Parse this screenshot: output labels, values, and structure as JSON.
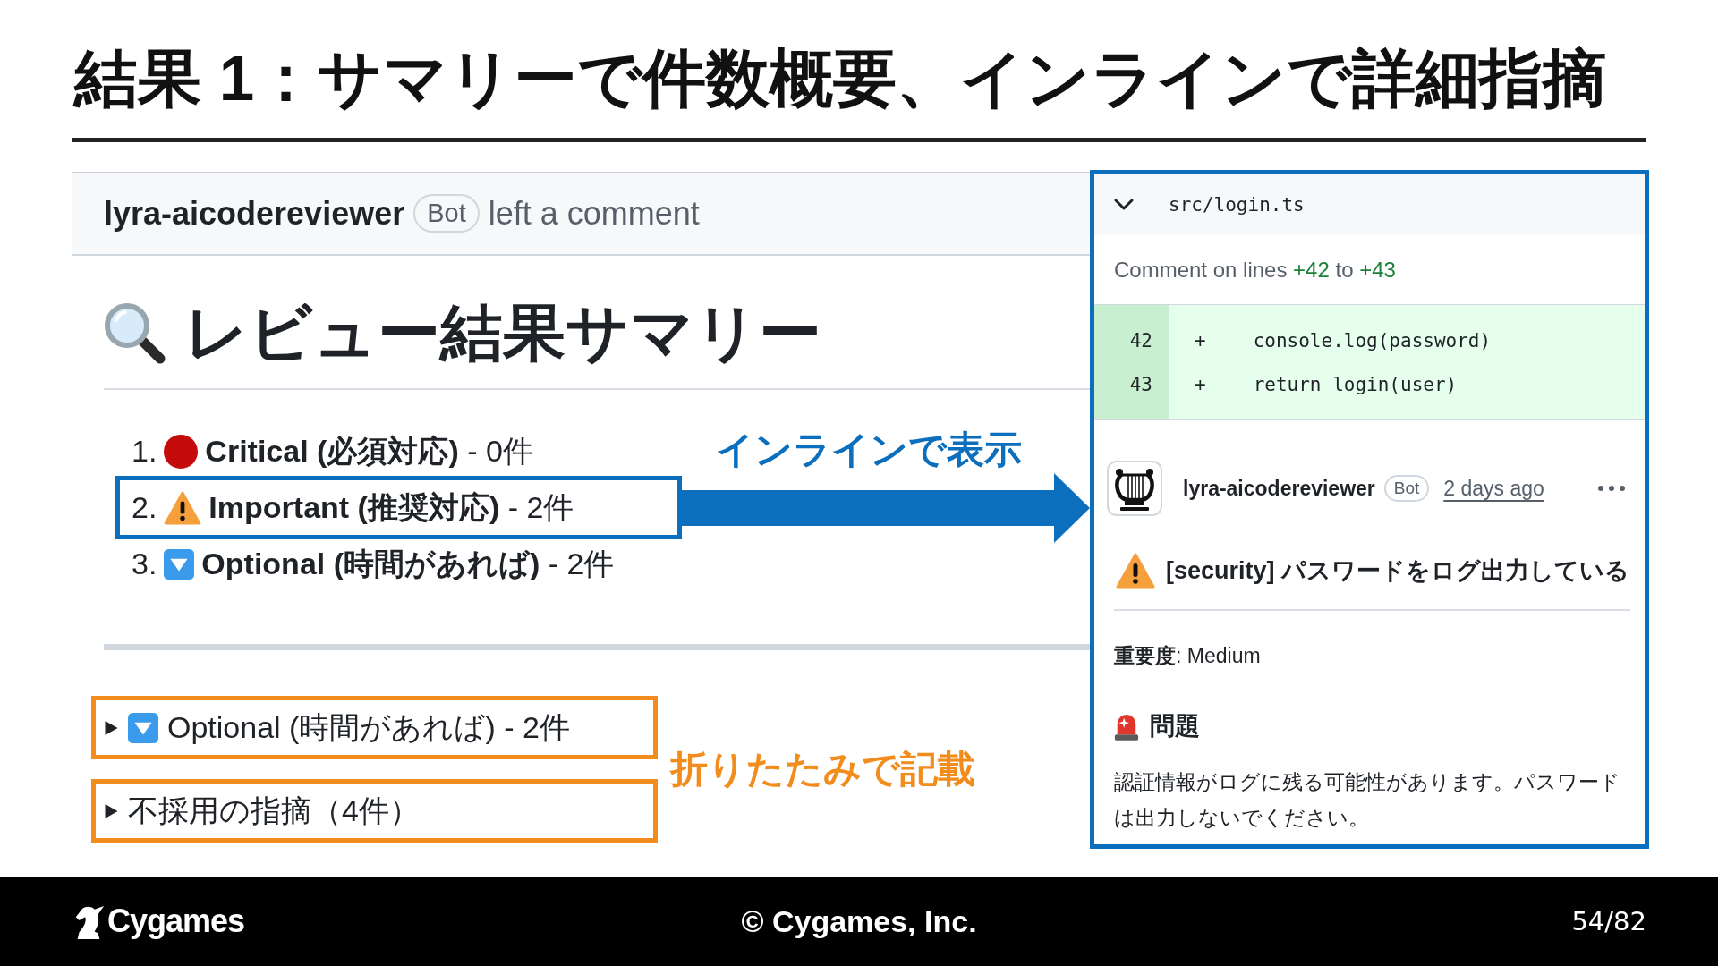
{
  "slide": {
    "title": "結果 1：サマリーで件数概要、インラインで詳細指摘"
  },
  "review_comment": {
    "author": "lyra-aicodereviewer",
    "badge": "Bot",
    "action": "left a comment",
    "heading": "レビュー結果サマリー",
    "summary_items": [
      {
        "number": "1.",
        "kind": "critical",
        "label": "**Critical (必須対応)** - 0件",
        "highlighted": false
      },
      {
        "number": "2.",
        "kind": "important",
        "label": "**Important (推奨対応)** - 2件",
        "highlighted": true
      },
      {
        "number": "3.",
        "kind": "optional",
        "label": "**Optional (時間があれば)** - 2件",
        "highlighted": false
      }
    ],
    "collapsed_sections": [
      {
        "kind": "optional",
        "label": "Optional (時間があれば) - 2件",
        "expanded": false,
        "highlighted": true
      },
      {
        "kind": "rejected",
        "label": "不採用の指摘（4件）",
        "expanded": false,
        "highlighted": true
      }
    ]
  },
  "callouts": [
    {
      "kind": "inline",
      "text": "インラインで表示"
    },
    {
      "kind": "folded",
      "text": "折りたたみで記載"
    }
  ],
  "inline_comment": {
    "file": {
      "path": "src/login.ts",
      "expanded": true
    },
    "range": {
      "prefix": "Comment on lines",
      "start": "+42",
      "joiner": "to",
      "end": "+43"
    },
    "diff_lines": [
      {
        "number": "42",
        "sign": "+",
        "code": "console.log(password)"
      },
      {
        "number": "43",
        "sign": "+",
        "code": "return login(user)"
      }
    ],
    "comment": {
      "author": "lyra-aicodereviewer",
      "badge": "Bot",
      "time": "2 days ago",
      "kind": "important",
      "title": "[security] パスワードをログ出力している",
      "severity": "**重要度**: Medium",
      "section_heading": "問題",
      "body": "認証情報がログに残る可能性があります。パスワードは出力しないでください。"
    }
  },
  "footer": {
    "logo": "Cygames",
    "copyright": "© Cygames, Inc.",
    "page_number": "54/82"
  }
}
